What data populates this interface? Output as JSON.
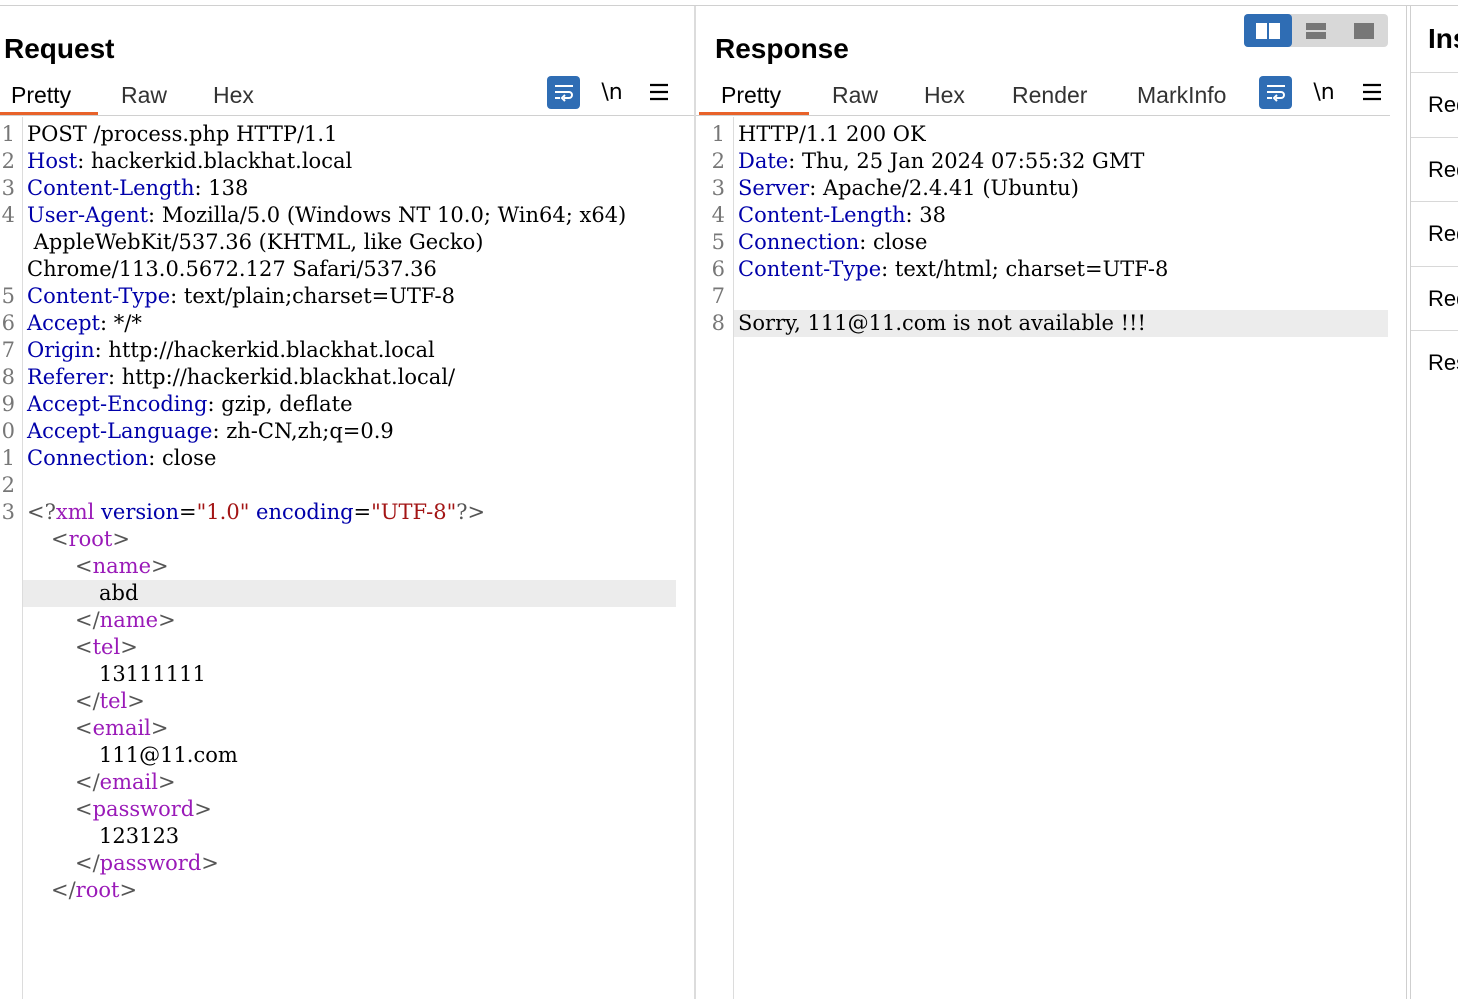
{
  "layout_toggle": {
    "options": [
      "side-by-side",
      "stacked",
      "single"
    ],
    "selected": "side-by-side"
  },
  "request": {
    "title": "Request",
    "tabs": [
      "Pretty",
      "Raw",
      "Hex"
    ],
    "active_tab": "Pretty",
    "tools": {
      "wrap": "wrap-lines-icon",
      "newline": "\\n",
      "menu": "hamburger-menu-icon"
    },
    "gutter_numbers": [
      "1",
      "2",
      "3",
      "4",
      "",
      "",
      "5",
      "6",
      "7",
      "8",
      "9",
      "0",
      "1",
      "2",
      "3",
      "",
      "",
      "",
      "",
      "",
      "",
      "",
      "",
      "",
      "",
      "",
      "",
      "",
      ""
    ],
    "header_lines": [
      {
        "name": "",
        "value": "POST /process.php HTTP/1.1"
      },
      {
        "name": "Host",
        "value": "hackerkid.blackhat.local"
      },
      {
        "name": "Content-Length",
        "value": "138"
      },
      {
        "name": "User-Agent",
        "value": "Mozilla/5.0 (Windows NT 10.0; Win64; x64)"
      },
      {
        "name": "",
        "value": " AppleWebKit/537.36 (KHTML, like Gecko)"
      },
      {
        "name": "",
        "value": "Chrome/113.0.5672.127 Safari/537.36"
      },
      {
        "name": "Content-Type",
        "value": "text/plain;charset=UTF-8"
      },
      {
        "name": "Accept",
        "value": "*/*"
      },
      {
        "name": "Origin",
        "value": "http://hackerkid.blackhat.local"
      },
      {
        "name": "Referer",
        "value": "http://hackerkid.blackhat.local/"
      },
      {
        "name": "Accept-Encoding",
        "value": "gzip, deflate"
      },
      {
        "name": "Accept-Language",
        "value": "zh-CN,zh;q=0.9"
      },
      {
        "name": "Connection",
        "value": "close"
      }
    ],
    "xml_decl": {
      "open": "<?",
      "name": "xml",
      "attr1": "version",
      "val1": "\"1.0\"",
      "attr2": "encoding",
      "val2": "\"UTF-8\"",
      "close": "?>"
    },
    "xml_lines": [
      {
        "indent": 1,
        "open": "<",
        "tag": "root",
        "close": ">"
      },
      {
        "indent": 2,
        "open": "<",
        "tag": "name",
        "close": ">"
      },
      {
        "indent": 3,
        "text": "abd",
        "highlight": true
      },
      {
        "indent": 2,
        "open": "</",
        "tag": "name",
        "close": ">"
      },
      {
        "indent": 2,
        "open": "<",
        "tag": "tel",
        "close": ">"
      },
      {
        "indent": 3,
        "text": "13111111"
      },
      {
        "indent": 2,
        "open": "</",
        "tag": "tel",
        "close": ">"
      },
      {
        "indent": 2,
        "open": "<",
        "tag": "email",
        "close": ">"
      },
      {
        "indent": 3,
        "text": "111@11.com"
      },
      {
        "indent": 2,
        "open": "</",
        "tag": "email",
        "close": ">"
      },
      {
        "indent": 2,
        "open": "<",
        "tag": "password",
        "close": ">"
      },
      {
        "indent": 3,
        "text": "123123"
      },
      {
        "indent": 2,
        "open": "</",
        "tag": "password",
        "close": ">"
      },
      {
        "indent": 1,
        "open": "</",
        "tag": "root",
        "close": ">"
      }
    ]
  },
  "response": {
    "title": "Response",
    "tabs": [
      "Pretty",
      "Raw",
      "Hex",
      "Render",
      "MarkInfo"
    ],
    "active_tab": "Pretty",
    "tools": {
      "wrap": "wrap-lines-icon",
      "newline": "\\n",
      "menu": "hamburger-menu-icon"
    },
    "gutter_numbers": [
      "1",
      "2",
      "3",
      "4",
      "5",
      "6",
      "7",
      "8"
    ],
    "lines": [
      {
        "name": "",
        "value": "HTTP/1.1 200 OK"
      },
      {
        "name": "Date",
        "value": "Thu, 25 Jan 2024 07:55:32 GMT"
      },
      {
        "name": "Server",
        "value": "Apache/2.4.41 (Ubuntu)"
      },
      {
        "name": "Content-Length",
        "value": "38"
      },
      {
        "name": "Connection",
        "value": "close"
      },
      {
        "name": "Content-Type",
        "value": "text/html; charset=UTF-8"
      },
      {
        "name": "",
        "value": ""
      },
      {
        "name": "",
        "value": "Sorry, 111@11.com is not available !!!",
        "highlight": true
      }
    ]
  },
  "inspector": {
    "title": "Inspector",
    "items": [
      "Request attributes",
      "Request query parameters",
      "Request body parameters",
      "Request cookies",
      "Response headers"
    ]
  }
}
